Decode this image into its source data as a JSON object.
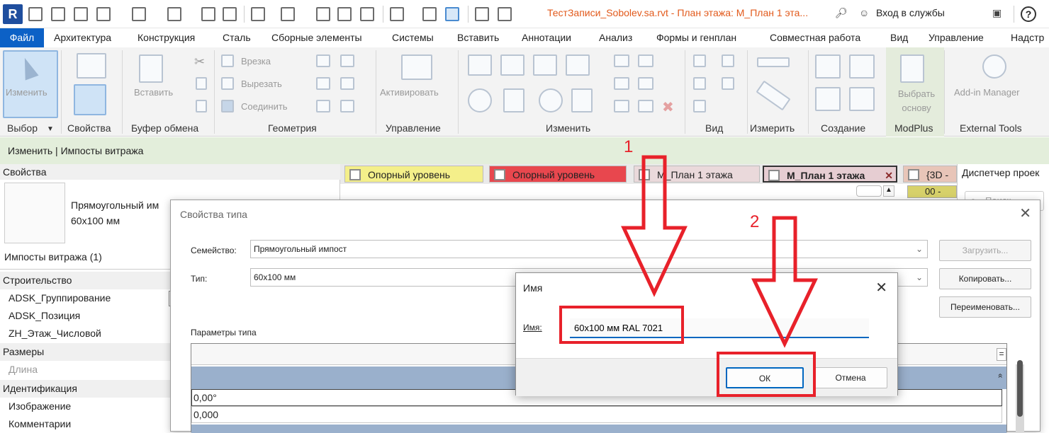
{
  "app": {
    "logo": "R",
    "title": "ТестЗаписи_Sobolev.sa.rvt - План этажа: М_План 1 эта...",
    "sign_in": "Вход в службы",
    "help": "?"
  },
  "tabs": [
    "Файл",
    "Архитектура",
    "Конструкция",
    "Сталь",
    "Сборные элементы",
    "Системы",
    "Вставить",
    "Аннотации",
    "Анализ",
    "Формы и генплан",
    "Совместная работа",
    "Вид",
    "Управление",
    "Надстр"
  ],
  "ribbon": {
    "buttons": {
      "modify": "Изменить",
      "paste": "Вставить",
      "cope": "Врезка",
      "cut": "Вырезать",
      "join": "Соединить",
      "activate": "Активировать",
      "select_basis": "Выбрать основу",
      "addin_manager": "Add-in Manager"
    },
    "groups": [
      "Выбор",
      "Свойства",
      "Буфер обмена",
      "Геометрия",
      "Управление",
      "Изменить",
      "Вид",
      "Измерить",
      "Создание",
      "ModPlus",
      "External Tools"
    ]
  },
  "context_bar": "Изменить | Импосты витража",
  "properties": {
    "header": "Свойства",
    "type_name_line1": "Прямоугольный им",
    "type_name_line2": "60x100 мм",
    "instance_count": "Импосты витража (1)",
    "rows": [
      {
        "kind": "cat",
        "label": "Строительство"
      },
      {
        "kind": "item",
        "label": "ADSK_Группирование"
      },
      {
        "kind": "item",
        "label": "ADSK_Позиция"
      },
      {
        "kind": "item",
        "label": "ZH_Этаж_Числовой"
      },
      {
        "kind": "cat",
        "label": "Размеры"
      },
      {
        "kind": "dim",
        "label": "Длина"
      },
      {
        "kind": "cat",
        "label": "Идентификация"
      },
      {
        "kind": "item",
        "label": "Изображение"
      },
      {
        "kind": "item",
        "label": "Комментарии"
      }
    ]
  },
  "view_tabs": [
    {
      "label": "Опорный уровень",
      "color": "#f4ef8a"
    },
    {
      "label": "Опорный уровень",
      "color": "#e8474e"
    },
    {
      "label": "М_План 1 этажа",
      "color": "#ead9db"
    },
    {
      "label": "М_План 1 этажа",
      "color": "#e6cdd2"
    },
    {
      "label": "{3D -",
      "color": "#e8c5b8"
    }
  ],
  "project_browser": {
    "title": "Диспетчер проек",
    "search": "Поиск",
    "item": "00 -"
  },
  "type_dialog": {
    "title": "Свойства типа",
    "family_label": "Семейство:",
    "family_value": "Прямоугольный импост",
    "type_label": "Тип:",
    "type_value": "60x100 мм",
    "load_button": "Загрузить...",
    "duplicate_button": "Копировать...",
    "rename_button": "Переименовать...",
    "params_label": "Параметры типа",
    "grid_header_symbol": "=",
    "collapse_symbol": "»",
    "row_values": [
      "0,00°",
      "0,000"
    ]
  },
  "name_dialog": {
    "title": "Имя",
    "label": "Имя:",
    "value": "60x100 мм RAL 7021",
    "ok": "ОК",
    "cancel": "Отмена"
  },
  "annotations": {
    "step1": "1",
    "step2": "2",
    "color": "#e8212a"
  }
}
